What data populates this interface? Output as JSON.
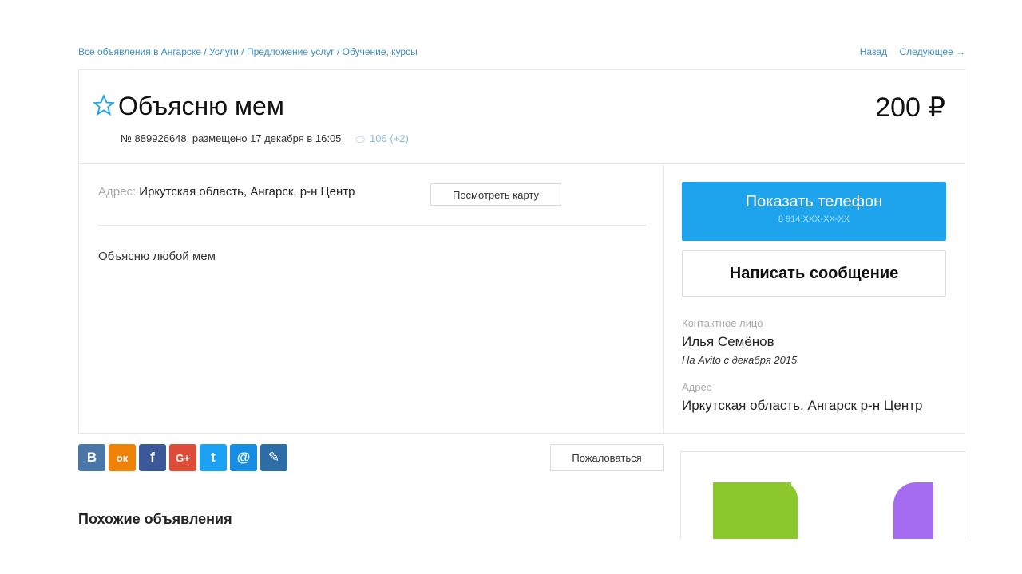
{
  "breadcrumbs": {
    "items": [
      "Все объявления в Ангарске",
      "Услуги",
      "Предложение услуг",
      "Обучение, курсы"
    ],
    "separator": "/"
  },
  "nav": {
    "back": "Назад",
    "next": "Следующее →"
  },
  "listing": {
    "title": "Объясню мем",
    "price": "200 ₽",
    "meta": "№ 889926648, размещено 17 декабря в 16:05",
    "views": "106 (+2)",
    "address_label": "Адрес:",
    "address_value": "Иркутская область, Ангарск, р-н Центр",
    "map_button": "Посмотреть карту",
    "description": "Объясню любой мем"
  },
  "sidebar": {
    "phone_button": "Показать телефон",
    "phone_masked": "8 914 XXX-XX-XX",
    "message_button": "Написать сообщение",
    "contact_label": "Контактное лицо",
    "contact_name": "Илья Семёнов",
    "since": "На Avito с декабря 2015",
    "address_label": "Адрес",
    "address": "Иркутская область, Ангарск р-н Центр"
  },
  "social": [
    {
      "name": "vk",
      "label": "В",
      "color": "#4a76a8"
    },
    {
      "name": "ok",
      "label": "ок",
      "color": "#ee8208"
    },
    {
      "name": "facebook",
      "label": "f",
      "color": "#3b5998"
    },
    {
      "name": "google-plus",
      "label": "G+",
      "color": "#dd4b39"
    },
    {
      "name": "twitter",
      "label": "t",
      "color": "#1da1f2"
    },
    {
      "name": "mail",
      "label": "@",
      "color": "#168de2"
    },
    {
      "name": "livejournal",
      "label": "✎",
      "color": "#2e6ea6"
    }
  ],
  "complain_button": "Пожаловаться",
  "similar_heading": "Похожие объявления",
  "colors": {
    "accent": "#1da4ec",
    "link": "#3a8fc7"
  }
}
